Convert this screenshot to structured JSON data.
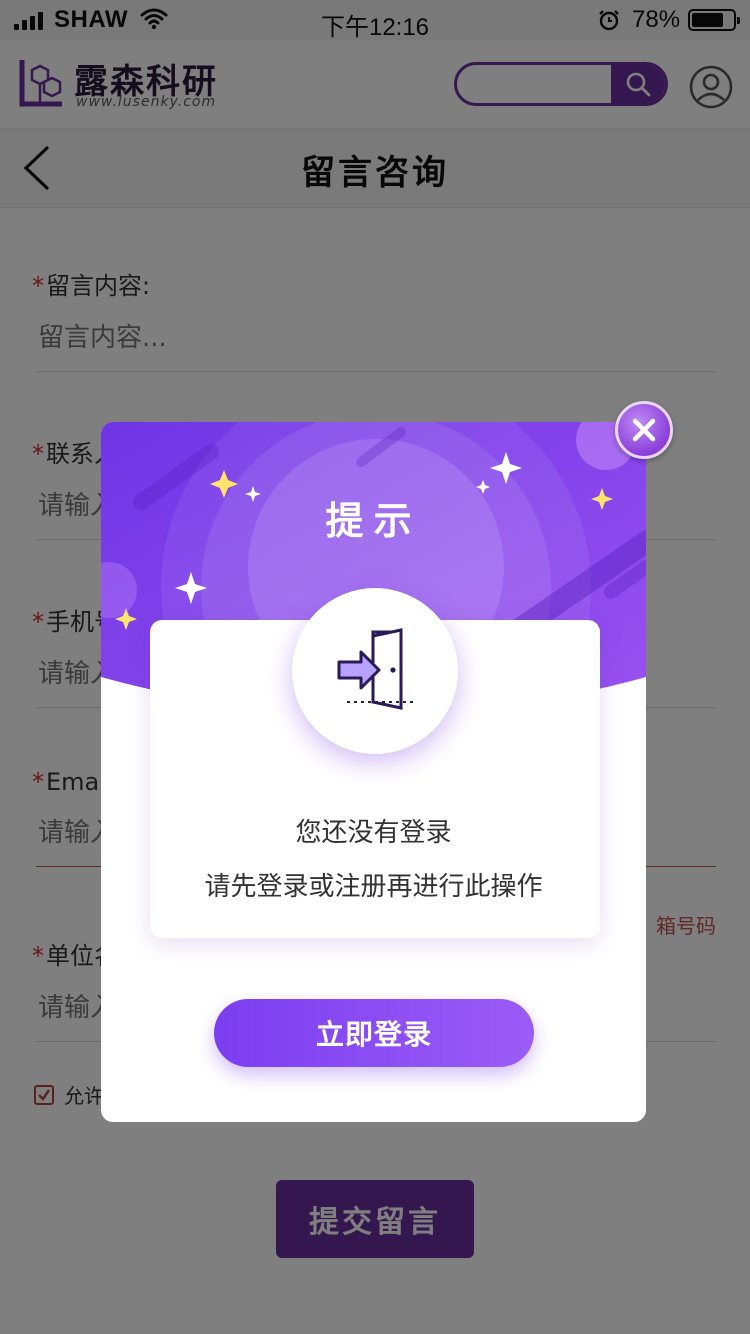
{
  "status_bar": {
    "carrier": "SHAW",
    "time": "下午12:16",
    "battery_percent": "78%",
    "battery_level": 0.78
  },
  "header": {
    "logo_name": "露森科研",
    "logo_url": "www.lusenky.com",
    "search_placeholder": ""
  },
  "nav": {
    "title": "留言咨询"
  },
  "form": {
    "fields": [
      {
        "label": "留言内容:",
        "placeholder": "留言内容..."
      },
      {
        "label": "联系人",
        "placeholder": "请输入"
      },
      {
        "label": "手机号",
        "placeholder": "请输入"
      },
      {
        "label": "Email",
        "placeholder": "请输入",
        "error": "箱号码"
      },
      {
        "label": "单位名",
        "placeholder": "请输入"
      }
    ],
    "agree_text": "允许",
    "submit_label": "提交留言"
  },
  "modal": {
    "title": "提示",
    "message_line1": "您还没有登录",
    "message_line2": "请先登录或注册再进行此操作",
    "login_button": "立即登录"
  },
  "colors": {
    "brand_purple": "#6a2ea0",
    "modal_gradient_start": "#7b3ef0",
    "modal_gradient_end": "#9b5cf6",
    "error_red": "#c0504d"
  }
}
